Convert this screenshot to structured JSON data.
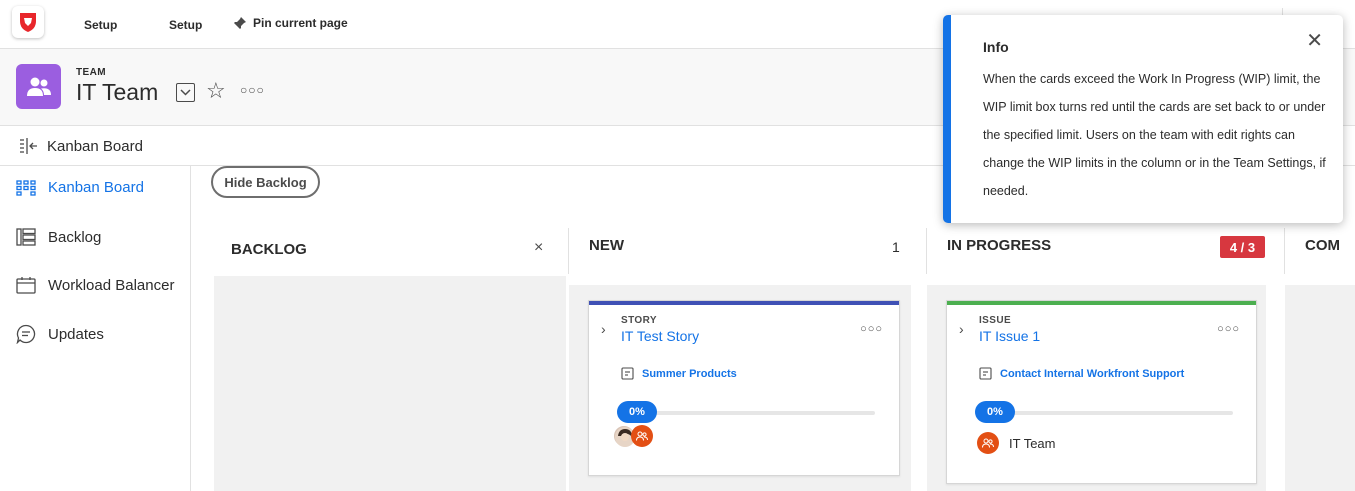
{
  "topbar": {
    "nav_items": [
      "Setup",
      "Setup"
    ],
    "pin_label": "Pin current page"
  },
  "header": {
    "object_type": "TEAM",
    "title": "IT Team"
  },
  "breadcrumb": {
    "label": "Kanban Board"
  },
  "sidebar": {
    "items": [
      {
        "label": "Kanban Board",
        "icon": "kanban-icon",
        "active": true
      },
      {
        "label": "Backlog",
        "icon": "backlog-icon",
        "active": false
      },
      {
        "label": "Workload Balancer",
        "icon": "calendar-icon",
        "active": false
      },
      {
        "label": "Updates",
        "icon": "chat-icon",
        "active": false
      }
    ]
  },
  "board": {
    "hide_backlog_label": "Hide Backlog",
    "columns": [
      {
        "title": "BACKLOG",
        "count": ""
      },
      {
        "title": "NEW",
        "count": "1"
      },
      {
        "title": "IN PROGRESS",
        "wip": "4 / 3"
      },
      {
        "title": "COM"
      }
    ],
    "cards": [
      {
        "type": "STORY",
        "title": "IT Test Story",
        "project": "Summer Products",
        "progress": "0%",
        "bar_color": "#3f51b5",
        "assignee": ""
      },
      {
        "type": "ISSUE",
        "title": "IT Issue 1",
        "project": "Contact Internal Workfront Support",
        "progress": "0%",
        "bar_color": "#4caf50",
        "assignee": "IT Team"
      }
    ]
  },
  "popover": {
    "title": "Info",
    "body": "When the cards exceed the Work In Progress (WIP) limit, the WIP limit box turns red until the cards are set back to or under the specified limit. Users on the team with edit rights can change the WIP limits in the column or in the Team Settings, if needed."
  },
  "colors": {
    "accent": "#1473e6",
    "wip_exceeded": "#d7373f",
    "team": "#9b5ee0"
  }
}
